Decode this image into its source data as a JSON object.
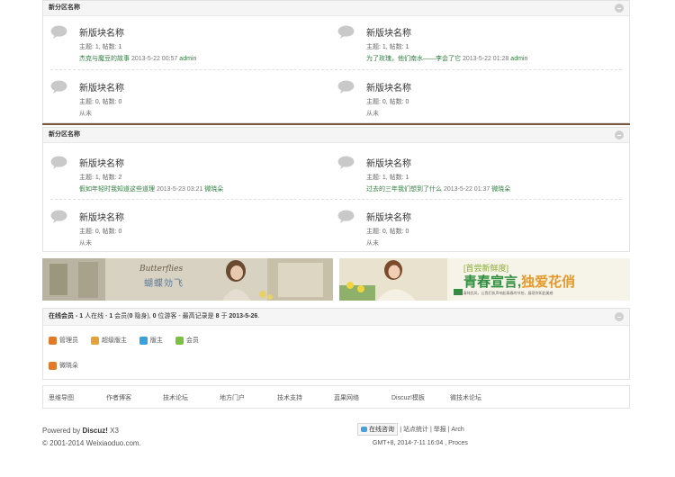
{
  "sections": [
    {
      "title": "新分区名称",
      "forums": [
        {
          "name": "新版块名称",
          "stats": "主题: 1, 帖数: 1",
          "last_title": "杰克与魔豆的故事",
          "last_time": "2013-5-22 00:57",
          "last_user": "admin"
        },
        {
          "name": "新版块名称",
          "stats": "主题: 1, 帖数: 1",
          "last_title": "为了玫瑰，他们南水——李会了它",
          "last_time": "2013-5-22 01:28",
          "last_user": "admin"
        },
        {
          "name": "新版块名称",
          "stats": "主题: 0, 帖数: 0",
          "last_never": "从未"
        },
        {
          "name": "新版块名称",
          "stats": "主题: 0, 帖数: 0",
          "last_never": "从未"
        }
      ]
    },
    {
      "title": "新分区名称",
      "forums": [
        {
          "name": "新版块名称",
          "stats": "主题: 1, 帖数: 2",
          "last_title": "假如年轻时我知道这些道理",
          "last_time": "2013-5-23 03:21",
          "last_user": "微晓朵"
        },
        {
          "name": "新版块名称",
          "stats": "主题: 1, 帖数: 1",
          "last_title": "过去的三年我们想到了什么",
          "last_time": "2013-5-22 01:37",
          "last_user": "微晓朵"
        },
        {
          "name": "新版块名称",
          "stats": "主题: 0, 帖数: 0",
          "last_never": "从未"
        },
        {
          "name": "新版块名称",
          "stats": "主题: 0, 帖数: 0",
          "last_never": "从未"
        }
      ]
    }
  ],
  "banners": {
    "left": {
      "script": "Butterflies",
      "title": "蝴蝶効飞"
    },
    "right": {
      "tag": "[首尝新鲜度]",
      "headline_a": "青春宣言,",
      "headline_b": "独爱花俏",
      "sub": "NEW 清纯优风，让我们执声响起青春的节拍，展现你如此美感"
    }
  },
  "online": {
    "text_a": "在线会员 - ",
    "text_b": "1",
    "text_c": " 人在线 - ",
    "text_d": "1",
    "text_e": " 会员(",
    "text_f": "0",
    "text_g": " 隐身), ",
    "text_h": "0",
    "text_i": " 位游客 - 最高记录是 ",
    "text_j": "8",
    "text_k": " 于 ",
    "text_l": "2013-5-26",
    "text_m": ".",
    "legend": [
      {
        "label": "管理员",
        "color": "#e07a2a"
      },
      {
        "label": "超级版主",
        "color": "#e5a13a"
      },
      {
        "label": "版主",
        "color": "#3aa0d9"
      },
      {
        "label": "会员",
        "color": "#7cc043"
      }
    ],
    "user": {
      "name": "微晓朵",
      "color": "#e07a2a"
    }
  },
  "links": [
    "思维导图",
    "作者博客",
    "技术论坛",
    "地方门户",
    "技术支持",
    "蓝果网络",
    "Discuz!模板",
    "微技术论坛"
  ],
  "footer": {
    "powered_prefix": "Powered by ",
    "powered_name": "Discuz!",
    "powered_ver": " X3",
    "copyright": "© 2001-2014 Weixiaoduo.com.",
    "consult_btn": "在线咨询",
    "links_line": "| 站点统计 | 举报 | Arch",
    "time_line": "GMT+8, 2014-7-11 16:04 , Proces"
  },
  "colors": {
    "accent_green": "#2f7d3e",
    "divider_brown": "#7a5a3c"
  }
}
